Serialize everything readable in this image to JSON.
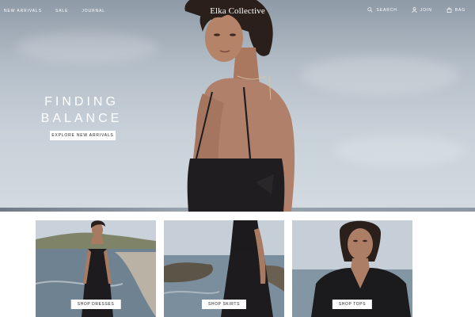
{
  "header": {
    "nav_left": [
      "NEW ARRIVALS",
      "SALE",
      "JOURNAL"
    ],
    "brand": "Elka Collective",
    "nav_right": [
      {
        "label": "SEARCH",
        "icon": "search-icon"
      },
      {
        "label": "JOIN",
        "icon": "user-icon"
      },
      {
        "label": "BAG",
        "icon": "bag-icon"
      }
    ]
  },
  "hero": {
    "title_line1": "FINDING",
    "title_line2": "BALANCE",
    "cta": "EXPLORE NEW ARRIVALS"
  },
  "categories": [
    {
      "cta": "SHOP DRESSES"
    },
    {
      "cta": "SHOP SKIRTS"
    },
    {
      "cta": "SHOP TOPS"
    }
  ]
}
